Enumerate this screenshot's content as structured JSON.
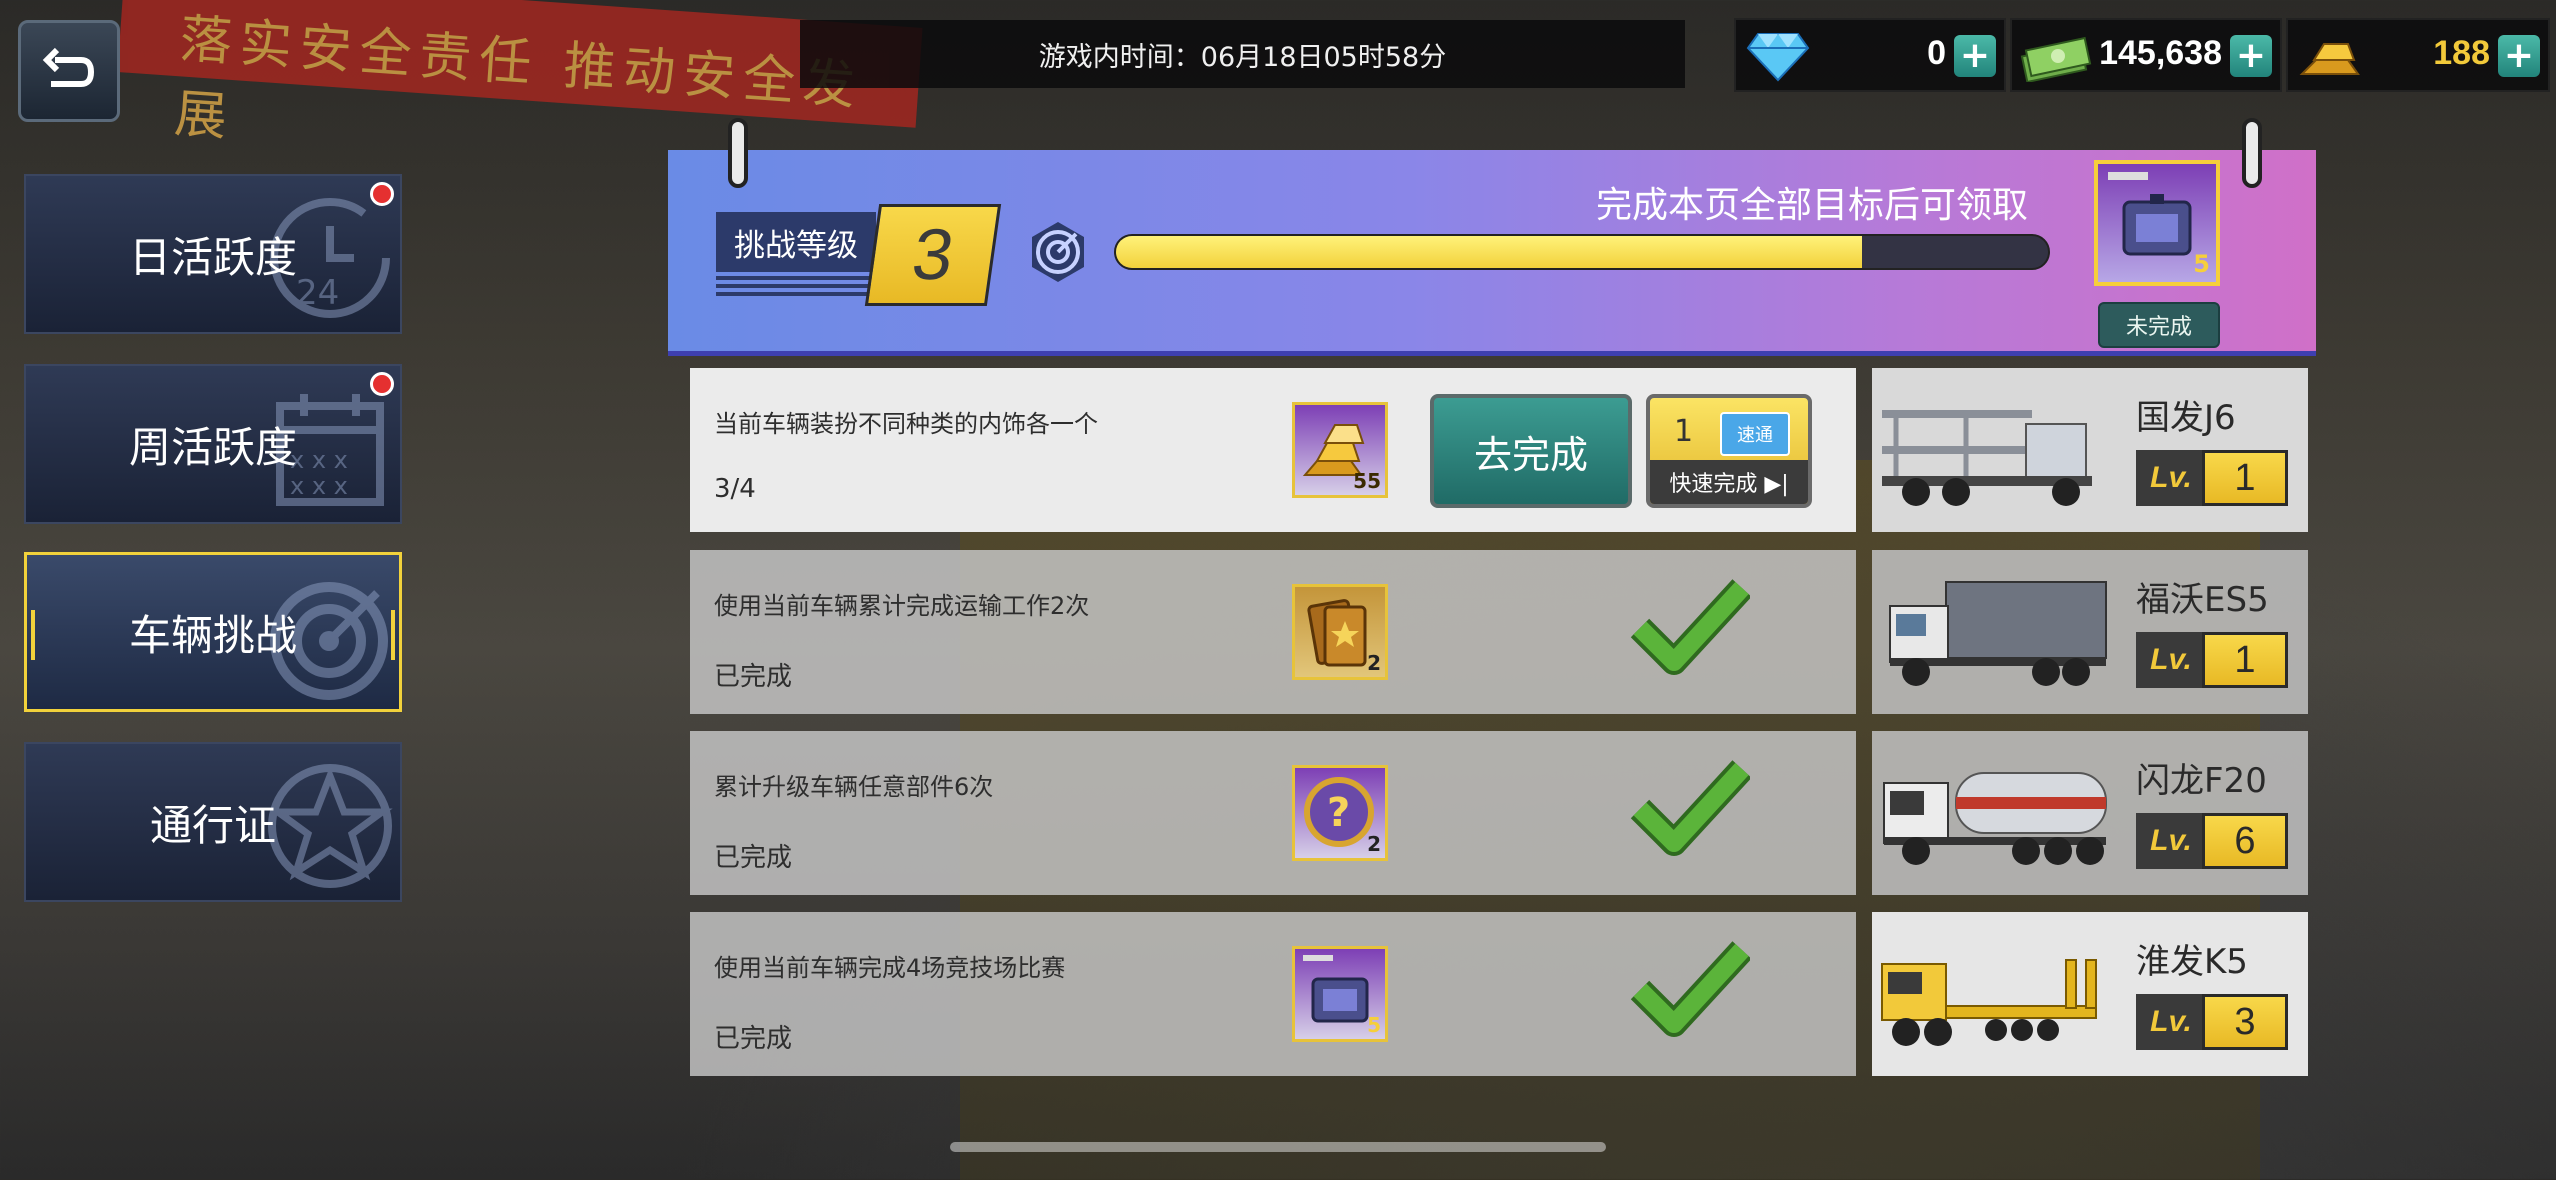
{
  "background": {
    "banner_text": "落实安全责任  推动安全发展"
  },
  "topbar": {
    "game_time": "游戏内时间：06月18日05时58分",
    "currencies": [
      {
        "icon": "diamond-icon",
        "amount": "0",
        "color": "#ffffff"
      },
      {
        "icon": "cash-icon",
        "amount": "145,638",
        "color": "#ffffff"
      },
      {
        "icon": "gold-bar-icon",
        "amount": "188",
        "color": "#f2c93a"
      }
    ],
    "plus_label": "+"
  },
  "sidebar": {
    "items": [
      {
        "label": "日活跃度",
        "badge": true,
        "active": false,
        "icon": "clock-24-icon"
      },
      {
        "label": "周活跃度",
        "badge": true,
        "active": false,
        "icon": "calendar-icon"
      },
      {
        "label": "车辆挑战",
        "badge": false,
        "active": true,
        "icon": "target-icon"
      },
      {
        "label": "通行证",
        "badge": false,
        "active": false,
        "icon": "star-emblem-icon"
      }
    ]
  },
  "challenge": {
    "level_label": "挑战等级",
    "level": "3",
    "progress": 0.8,
    "claim_hint": "完成本页全部目标后可领取",
    "reward_count": "5",
    "reward_status": "未完成"
  },
  "tasks": [
    {
      "desc": "当前车辆装扮不同种类的内饰各一个",
      "status": "3/4",
      "reward_icon": "gold-bars-icon",
      "reward_count": "55",
      "done": false,
      "go_label": "去完成",
      "quick_count": "1",
      "quick_ticket": "速通",
      "quick_label": "快速完成 ▶|"
    },
    {
      "desc": "使用当前车辆累计完成运输工作2次",
      "status": "已完成",
      "reward_icon": "ticket-icon",
      "reward_count": "2",
      "done": true
    },
    {
      "desc": "累计升级车辆任意部件6次",
      "status": "已完成",
      "reward_icon": "mystery-coin-icon",
      "reward_count": "2",
      "done": true
    },
    {
      "desc": "使用当前车辆完成4场竞技场比赛",
      "status": "已完成",
      "reward_icon": "cargo-box-icon",
      "reward_count": "5",
      "done": true
    }
  ],
  "vehicles": [
    {
      "name": "国发J6",
      "lv_label": "Lv.",
      "level": "1",
      "icon": "car-carrier-truck-icon"
    },
    {
      "name": "福沃ES5",
      "lv_label": "Lv.",
      "level": "1",
      "icon": "box-truck-icon"
    },
    {
      "name": "闪龙F20",
      "lv_label": "Lv.",
      "level": "6",
      "icon": "tanker-truck-icon"
    },
    {
      "name": "淮发K5",
      "lv_label": "Lv.",
      "level": "3",
      "icon": "lowboy-truck-icon"
    }
  ]
}
